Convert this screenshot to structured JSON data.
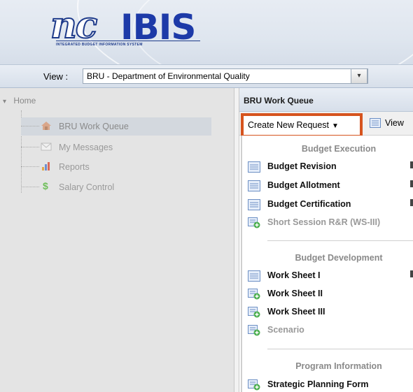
{
  "header": {
    "logo_script": "nc",
    "logo_main": "IBIS",
    "logo_tagline": "INTEGRATED BUDGET INFORMATION SYSTEM"
  },
  "viewbar": {
    "label": "View :",
    "selected": "BRU - Department of Environmental Quality"
  },
  "sidebar": {
    "home_label": "Home",
    "items": [
      {
        "label": "BRU Work Queue",
        "icon": "home-icon",
        "active": true
      },
      {
        "label": "My Messages",
        "icon": "envelope-icon",
        "active": false
      },
      {
        "label": "Reports",
        "icon": "bar-chart-icon",
        "active": false
      },
      {
        "label": "Salary Control",
        "icon": "dollar-icon",
        "active": false
      }
    ]
  },
  "main": {
    "title": "BRU Work Queue",
    "create_button": "Create New Request",
    "view_button": "View",
    "sections": [
      {
        "heading": "Budget Execution",
        "items": [
          {
            "label": "Budget Revision",
            "disabled": false
          },
          {
            "label": "Budget Allotment",
            "disabled": false
          },
          {
            "label": "Budget Certification",
            "disabled": false
          },
          {
            "label": "Short Session R&R (WS-III)",
            "disabled": true
          }
        ]
      },
      {
        "heading": "Budget Development",
        "items": [
          {
            "label": "Work Sheet I",
            "disabled": false
          },
          {
            "label": "Work Sheet II",
            "disabled": false
          },
          {
            "label": "Work Sheet III",
            "disabled": false
          },
          {
            "label": "Scenario",
            "disabled": true
          }
        ]
      },
      {
        "heading": "Program Information",
        "items": [
          {
            "label": "Strategic Planning Form",
            "disabled": false
          }
        ]
      }
    ]
  },
  "colors": {
    "highlight_border": "#d6541e",
    "logo_blue": "#1d3aa8",
    "sidebar_bg": "#e4e4e4"
  }
}
